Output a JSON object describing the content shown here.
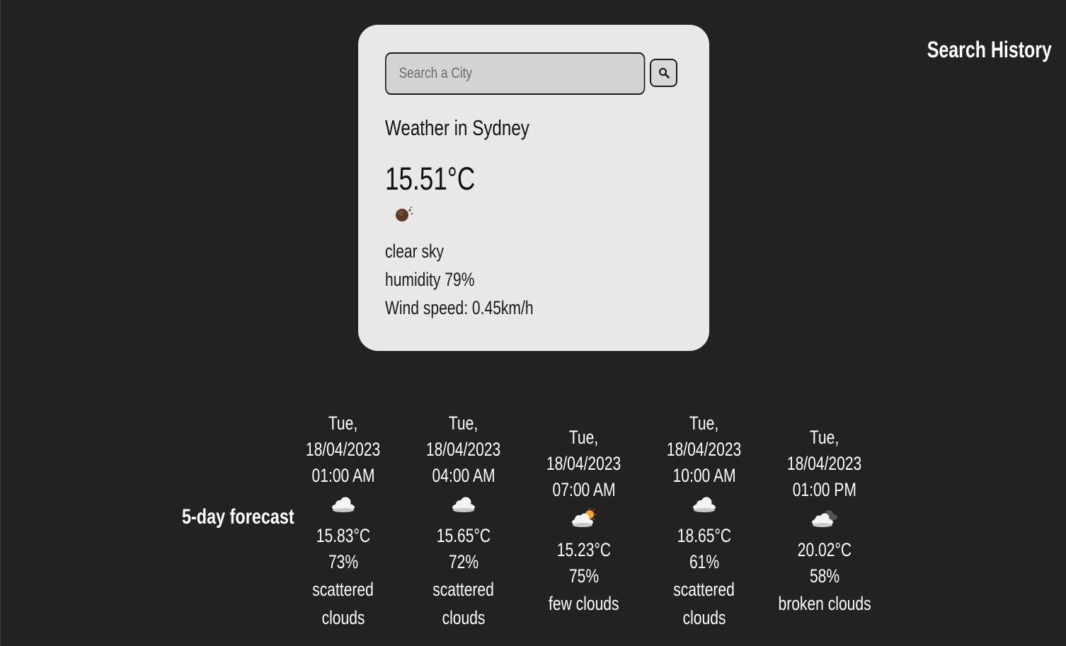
{
  "search": {
    "placeholder": "Search a City",
    "button_icon": "search-icon"
  },
  "current": {
    "title": "Weather in Sydney",
    "temperature": "15.51°C",
    "icon": "clear-sky-night-icon",
    "description": "clear sky",
    "humidity": "humidity 79%",
    "wind": "Wind speed: 0.45km/h"
  },
  "history": {
    "title": "Search History"
  },
  "forecast": {
    "label": "5-day forecast",
    "items": [
      {
        "day": "Tue,",
        "date": "18/04/2023",
        "time": "01:00 AM",
        "icon": "scattered-clouds-icon",
        "temp": "15.83°C",
        "humidity": "73%",
        "desc_line1": "scattered",
        "desc_line2": "clouds"
      },
      {
        "day": "Tue,",
        "date": "18/04/2023",
        "time": "04:00 AM",
        "icon": "scattered-clouds-icon",
        "temp": "15.65°C",
        "humidity": "72%",
        "desc_line1": "scattered",
        "desc_line2": "clouds"
      },
      {
        "day": "Tue,",
        "date": "18/04/2023",
        "time": "07:00 AM",
        "icon": "few-clouds-icon",
        "temp": "15.23°C",
        "humidity": "75%",
        "desc_line1": "few clouds",
        "desc_line2": ""
      },
      {
        "day": "Tue,",
        "date": "18/04/2023",
        "time": "10:00 AM",
        "icon": "scattered-clouds-icon",
        "temp": "18.65°C",
        "humidity": "61%",
        "desc_line1": "scattered",
        "desc_line2": "clouds"
      },
      {
        "day": "Tue,",
        "date": "18/04/2023",
        "time": "01:00 PM",
        "icon": "broken-clouds-icon",
        "temp": "20.02°C",
        "humidity": "58%",
        "desc_line1": "broken clouds",
        "desc_line2": ""
      }
    ]
  }
}
